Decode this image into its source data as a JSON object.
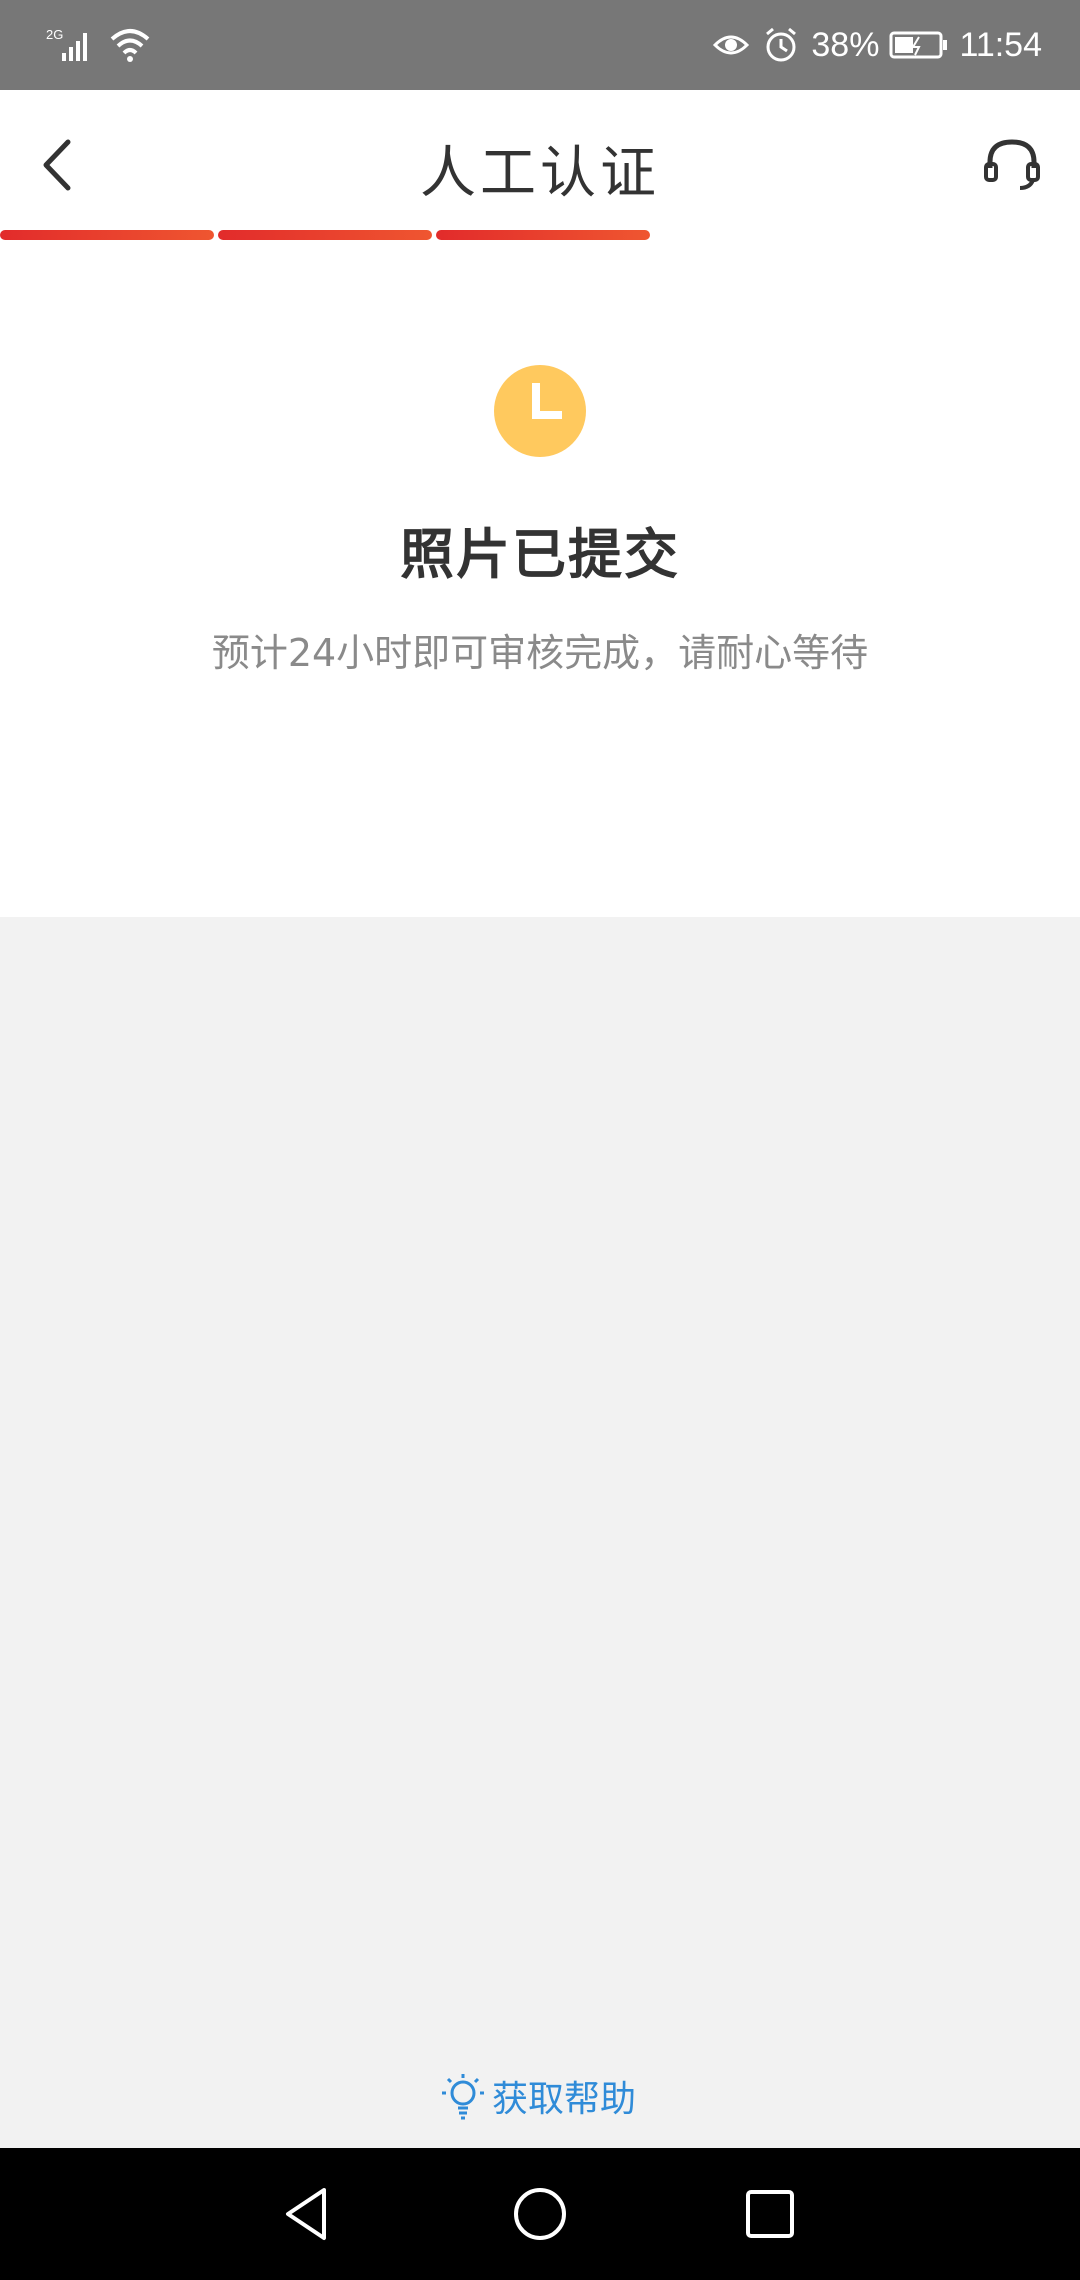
{
  "status_bar": {
    "network": "2G",
    "battery_percent": "38%",
    "time": "11:54"
  },
  "header": {
    "title": "人工认证",
    "progress_steps_completed": 3,
    "progress_steps_total": 3
  },
  "content": {
    "headline": "照片已提交",
    "subtext": "预计24小时即可审核完成，请耐心等待"
  },
  "help": {
    "label": "获取帮助"
  },
  "colors": {
    "accent_red": "#e22b2b",
    "clock_yellow": "#ffc95e",
    "link_blue": "#2f8bd8"
  },
  "icons": {
    "back": "back-arrow-icon",
    "support": "headset-icon",
    "status": "clock-icon",
    "help": "lightbulb-icon"
  }
}
